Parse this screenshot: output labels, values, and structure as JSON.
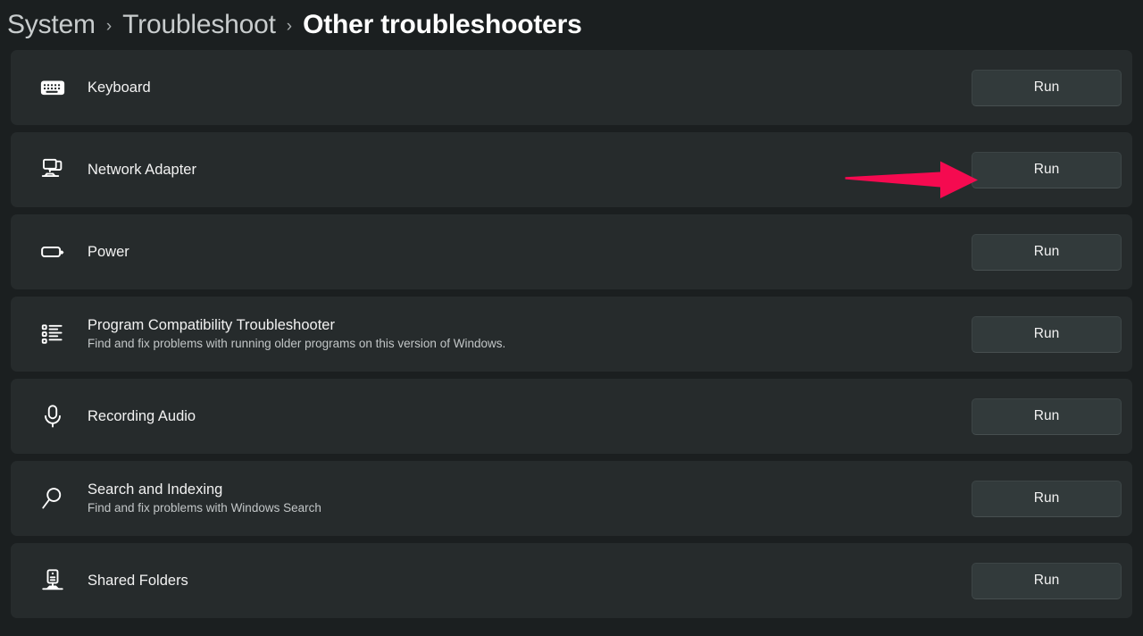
{
  "breadcrumb": {
    "separator": "›",
    "items": [
      {
        "label": "System",
        "current": false
      },
      {
        "label": "Troubleshoot",
        "current": false
      },
      {
        "label": "Other troubleshooters",
        "current": true
      }
    ]
  },
  "annotation": {
    "type": "arrow",
    "color": "#f50a50",
    "points_to": "run-button-network-adapter"
  },
  "troubleshooters": {
    "run_label": "Run",
    "items": [
      {
        "title": "Keyboard",
        "subtitle": "",
        "icon": "keyboard-icon",
        "run_label": "Run"
      },
      {
        "title": "Network Adapter",
        "subtitle": "",
        "icon": "network-adapter-icon",
        "run_label": "Run"
      },
      {
        "title": "Power",
        "subtitle": "",
        "icon": "battery-icon",
        "run_label": "Run"
      },
      {
        "title": "Program Compatibility Troubleshooter",
        "subtitle": "Find and fix problems with running older programs on this version of Windows.",
        "icon": "list-icon",
        "run_label": "Run"
      },
      {
        "title": "Recording Audio",
        "subtitle": "",
        "icon": "microphone-icon",
        "run_label": "Run"
      },
      {
        "title": "Search and Indexing",
        "subtitle": "Find and fix problems with Windows Search",
        "icon": "search-icon",
        "run_label": "Run"
      },
      {
        "title": "Shared Folders",
        "subtitle": "",
        "icon": "server-icon",
        "run_label": "Run"
      }
    ]
  }
}
